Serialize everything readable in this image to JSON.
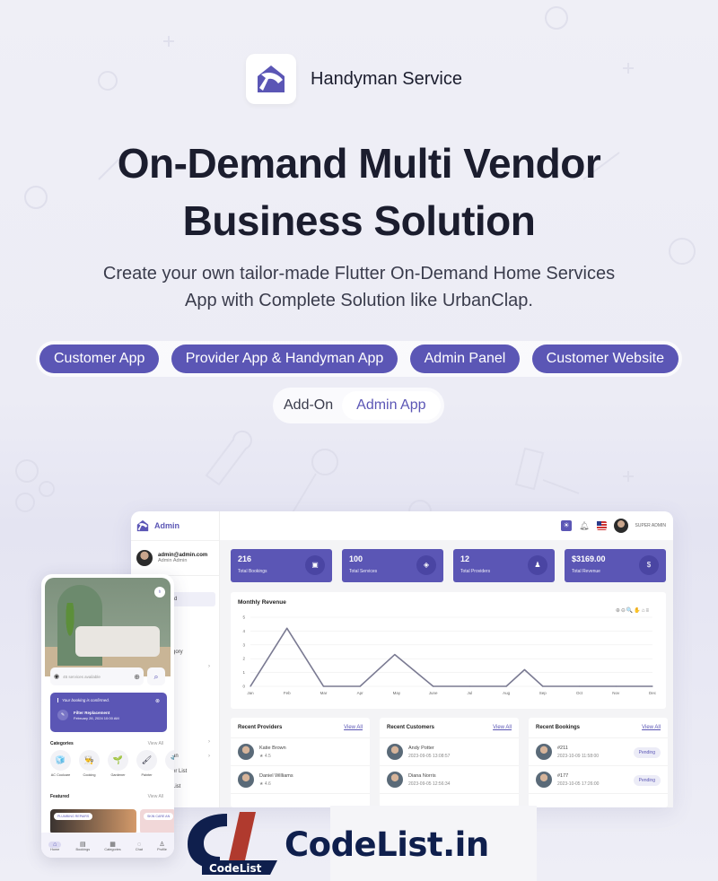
{
  "brand": {
    "name": "Handyman Service",
    "icon": "house-hammer-icon"
  },
  "headline": {
    "line1": "On-Demand Multi Vendor",
    "line2": "Business Solution"
  },
  "subline": {
    "line1": "Create your own tailor-made Flutter On-Demand Home Services",
    "line2": "App with Complete Solution like UrbanClap."
  },
  "products": [
    "Customer App",
    "Provider App & Handyman App",
    "Admin Panel",
    "Customer Website"
  ],
  "addon": {
    "label": "Add-On",
    "item": "Admin App"
  },
  "colors": {
    "accent": "#5b56b5",
    "dark_text": "#1b1d2e",
    "codelist_navy": "#0f1f4d",
    "codelist_red": "#b03a2e"
  },
  "admin": {
    "logo_label": "Admin",
    "user": {
      "email": "admin@admin.com",
      "name": "Admin Admin"
    },
    "sidebar_partial": [
      "rd",
      "gory",
      "an",
      "er List",
      "List"
    ],
    "topbar": {
      "role": "SUPER ADMIN",
      "icons": [
        "theme-icon",
        "bell-icon",
        "us-flag-icon",
        "avatar"
      ]
    },
    "stats": [
      {
        "value": "216",
        "label": "Total Bookings",
        "icon": "calendar-icon"
      },
      {
        "value": "100",
        "label": "Total Services",
        "icon": "service-icon"
      },
      {
        "value": "12",
        "label": "Total Providers",
        "icon": "providers-icon"
      },
      {
        "value": "$3169.00",
        "label": "Total Revenue",
        "icon": "dollar-icon"
      }
    ],
    "chart_title": "Monthly Revenue",
    "chart_tools": "⊕⊖🔍✋⌂≡",
    "recent_providers": {
      "title": "Recent Providers",
      "link": "View All",
      "rows": [
        {
          "name": "Katie Brown",
          "rating": "★ 4.5"
        },
        {
          "name": "Daniel Williams",
          "rating": "★ 4.6"
        }
      ]
    },
    "recent_customers": {
      "title": "Recent Customers",
      "link": "View All",
      "rows": [
        {
          "name": "Andy Potter",
          "date": "2023-09-05 13:08:57"
        },
        {
          "name": "Diana Norris",
          "date": "2023-09-05 12:56:34"
        }
      ]
    },
    "recent_bookings": {
      "title": "Recent Bookings",
      "link": "View All",
      "rows": [
        {
          "id": "#211",
          "date": "2023-10-09 11:58:00",
          "status": "Pending"
        },
        {
          "id": "#177",
          "date": "2023-10-05 17:26:00",
          "status": "Pending"
        }
      ]
    }
  },
  "chart_data": {
    "type": "line",
    "title": "Monthly Revenue",
    "categories": [
      "Jan",
      "Feb",
      "Mar",
      "Apr",
      "May",
      "June",
      "Jul",
      "Aug",
      "Sep",
      "Oct",
      "Nov",
      "Dec"
    ],
    "x": [
      0,
      1,
      2,
      3,
      3.95,
      5,
      6,
      7,
      7.5,
      8,
      9,
      10,
      11
    ],
    "values": [
      0,
      4.2,
      0,
      0,
      2.3,
      0,
      0,
      0,
      1.2,
      0,
      0,
      0,
      0
    ],
    "yticks": [
      "0",
      "1",
      "2",
      "3",
      "4",
      "5"
    ],
    "ylim": [
      0,
      5
    ],
    "grid": true,
    "xlabel": "",
    "ylabel": ""
  },
  "phone": {
    "search_placeholder": "45 services available",
    "booking_banner": {
      "message": "Your booking is confirmed.",
      "service": "Filter Replacement",
      "date": "February 26, 2024 10:00 AM"
    },
    "categories_title": "Categories",
    "view_all": "View All",
    "categories": [
      {
        "name": "AC Coolcare",
        "icon": "🧊"
      },
      {
        "name": "Cooking",
        "icon": "👨‍🍳"
      },
      {
        "name": "Gardener",
        "icon": "🌱"
      },
      {
        "name": "Painter",
        "icon": "🖌"
      },
      {
        "name": "Pl",
        "icon": "🔧"
      }
    ],
    "featured_title": "Featured",
    "featured": [
      "PLUMBING REPAIRS",
      "SKIN CARE AN"
    ],
    "nav": [
      {
        "label": "Home",
        "icon": "⌂"
      },
      {
        "label": "Bookings",
        "icon": "▤"
      },
      {
        "label": "Categories",
        "icon": "▦"
      },
      {
        "label": "Chat",
        "icon": "◌"
      },
      {
        "label": "Profile",
        "icon": "♙"
      }
    ]
  },
  "watermark": {
    "text": "CodeList.in",
    "mark_label": "CodeList"
  }
}
